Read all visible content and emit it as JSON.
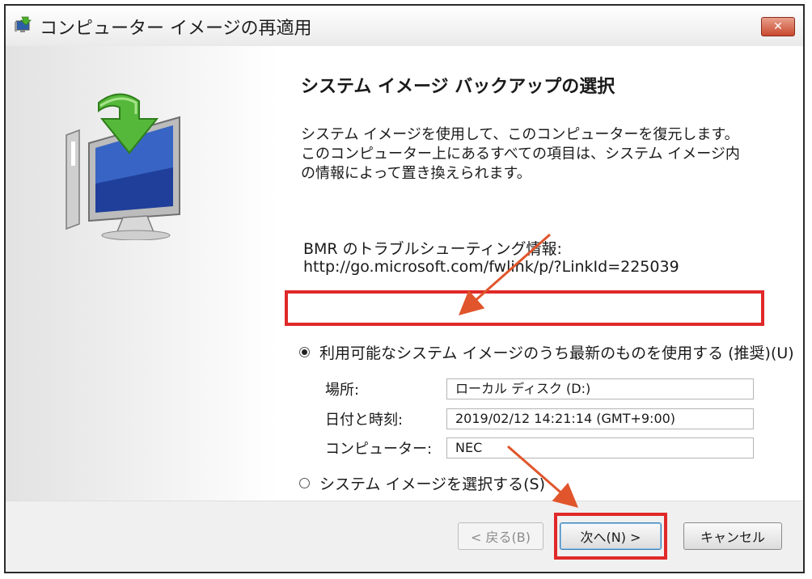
{
  "window": {
    "title": "コンピューター イメージの再適用",
    "close_label": "✕"
  },
  "main": {
    "heading": "システム イメージ バックアップの選択",
    "description": "システム イメージを使用して、このコンピューターを復元します。このコンピューター上にあるすべての項目は、システム イメージ内の情報によって置き換えられます。",
    "bmr_label": "BMR のトラブルシューティング情報:",
    "bmr_link": "http://go.microsoft.com/fwlink/p/?LinkId=225039"
  },
  "options": {
    "latest_label": "利用可能なシステム イメージのうち最新のものを使用する (推奨)(U)",
    "latest_selected": true,
    "select_label": "システム イメージを選択する(S)",
    "select_selected": false
  },
  "fields": {
    "location_label": "場所:",
    "location_value": "ローカル ディスク (D:)",
    "datetime_label": "日付と時刻:",
    "datetime_value": "2019/02/12 14:21:14 (GMT+9:00)",
    "computer_label": "コンピューター:",
    "computer_value": "NEC"
  },
  "buttons": {
    "back": "< 戻る(B)",
    "next": "次へ(N) >",
    "cancel": "キャンセル"
  },
  "icons": {
    "title_icon": "restore-computer-icon",
    "wizard_art": "monitor-with-green-arrow-icon"
  },
  "colors": {
    "highlight": "#e02929",
    "arrow": "#e0552b",
    "close_button": "#c9492f"
  }
}
